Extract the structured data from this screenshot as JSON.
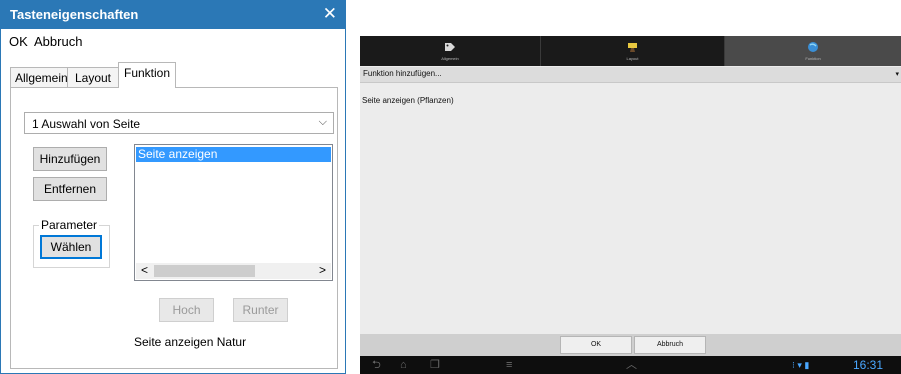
{
  "dialog": {
    "title": "Tasteneigenschaften",
    "close_glyph": "✕",
    "menu": {
      "ok": "OK",
      "cancel": "Abbruch"
    },
    "tabs": [
      "Allgemein",
      "Layout",
      "Funktion"
    ],
    "active_tab": "Funktion",
    "combo_value": "1 Auswahl von Seite",
    "combo_arrow": "⌵",
    "buttons": {
      "add": "Hinzufügen",
      "remove": "Entfernen",
      "choose": "Wählen",
      "up": "Hoch",
      "down": "Runter"
    },
    "parameter_group": "Parameter",
    "list_items": [
      "Seite anzeigen"
    ],
    "scroll_left": "<",
    "scroll_right": ">",
    "status_text": "Seite anzeigen Natur",
    "accent_color": "#2b78b6"
  },
  "tablet": {
    "tabs": [
      {
        "label": "Allgemein",
        "icon": "tag-icon"
      },
      {
        "label": "Layout",
        "icon": "brush-icon"
      },
      {
        "label": "Funktion",
        "icon": "globe-icon"
      }
    ],
    "active_tab": "Funktion",
    "add_function": "Funktion hinzufügen...",
    "dropdown_arrow": "▾",
    "function_entry": "Seite anzeigen (Pflanzen)",
    "buttons": {
      "ok": "OK",
      "cancel": "Abbruch"
    },
    "nav": {
      "back": "⮌",
      "home": "⌂",
      "recent": "❐",
      "menu": "≡",
      "up": "︿"
    },
    "clock": "16:31",
    "status_icons": "⁝ ▾ ▮",
    "accent_color": "#4aa7ff"
  }
}
